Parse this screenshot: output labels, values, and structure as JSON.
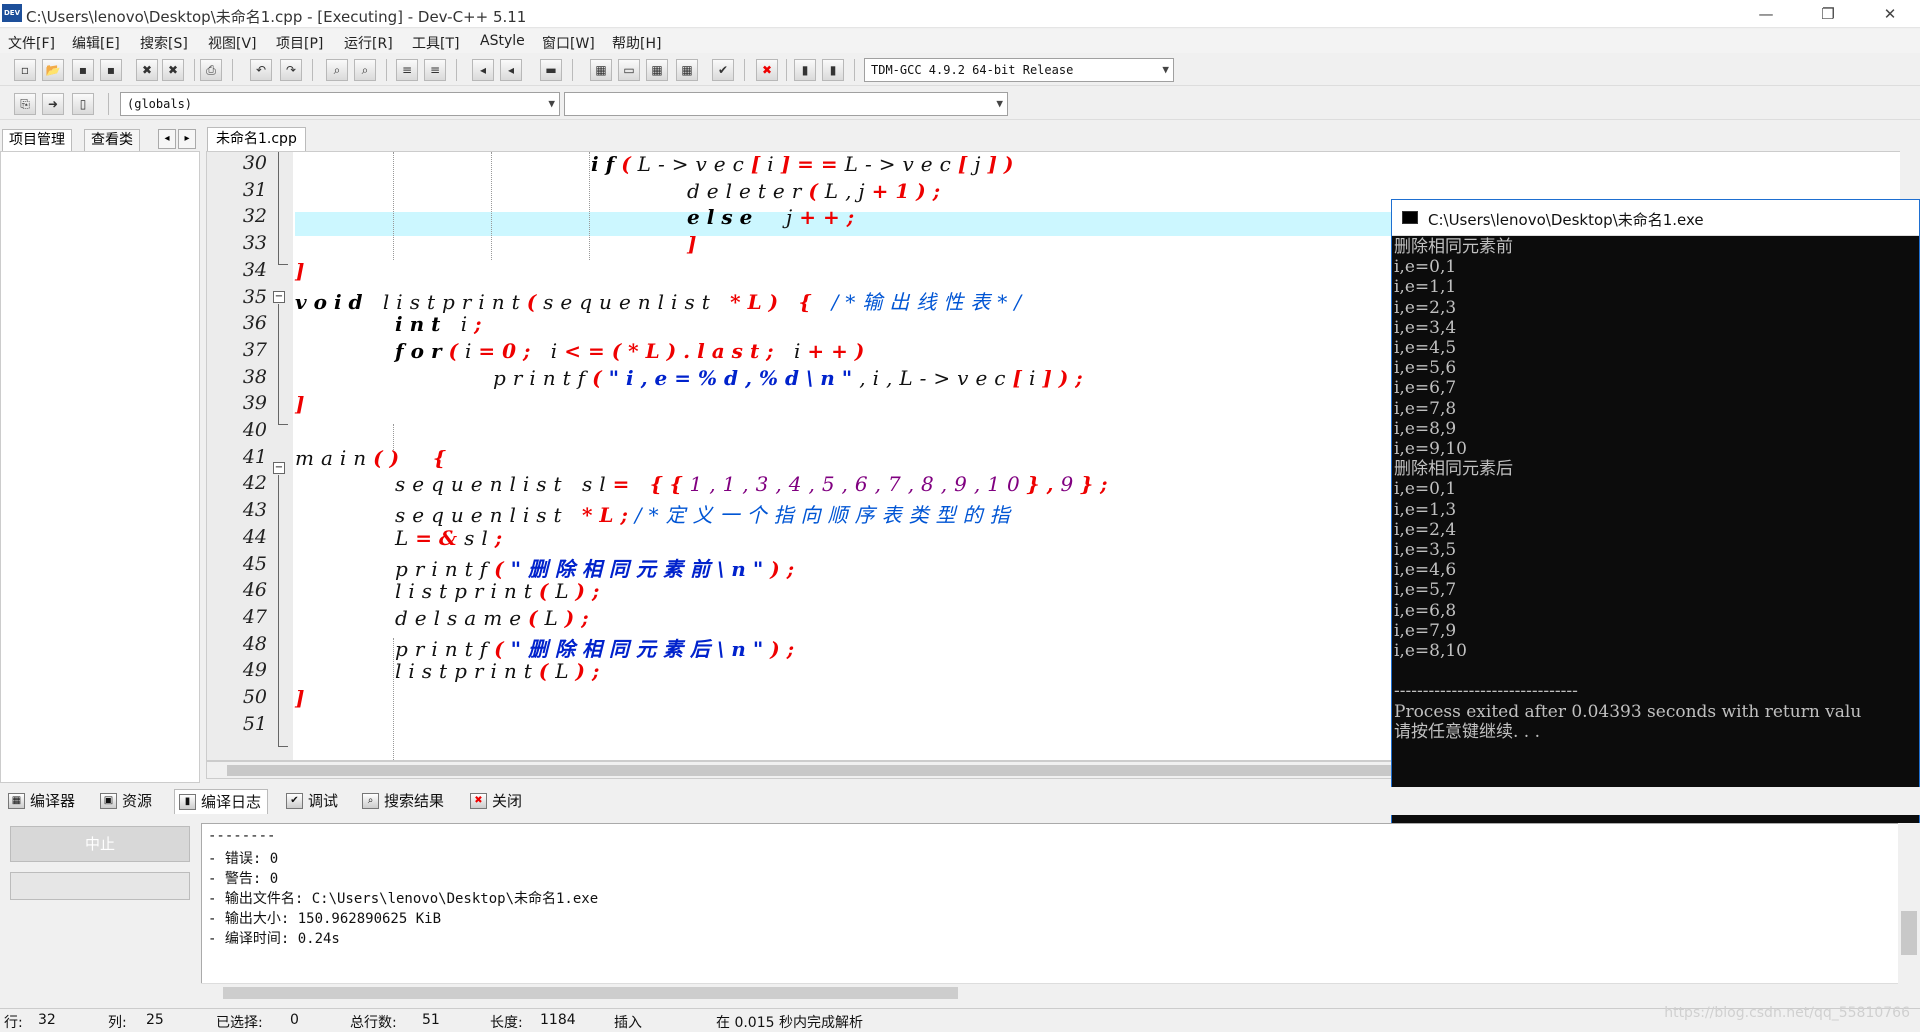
{
  "window": {
    "title": "C:\\Users\\lenovo\\Desktop\\未命名1.cpp - [Executing] - Dev-C++ 5.11",
    "app_icon": "DEV",
    "minimize": "—",
    "maximize": "❐",
    "close": "✕"
  },
  "menu": [
    "文件[F]",
    "编辑[E]",
    "搜索[S]",
    "视图[V]",
    "项目[P]",
    "运行[R]",
    "工具[T]",
    "AStyle",
    "窗口[W]",
    "帮助[H]"
  ],
  "toolbar": {
    "compiler_select": "TDM-GCC 4.9.2 64-bit Release",
    "scope_select": "(globals)",
    "symbol_select": ""
  },
  "left_tabs": [
    "项目管理",
    "查看类"
  ],
  "file_tab": "未命名1.cpp",
  "code": {
    "lines": [
      "30",
      "31",
      "32",
      "33",
      "34",
      "35",
      "36",
      "37",
      "38",
      "39",
      "40",
      "41",
      "42",
      "43",
      "44",
      "45",
      "46",
      "47",
      "48",
      "49",
      "50",
      "51"
    ],
    "l30": {
      "kw": "if",
      "a": "(",
      "b": "L->vec",
      "c": "[",
      "d": "i",
      "e": "]",
      "f": "==",
      "g": "L->vec",
      "h": "[",
      "i": "j",
      "j": "])"
    },
    "l31": {
      "a": "deleter",
      "b": "(",
      "c": "L,",
      "d": "j",
      "e": "+1);"
    },
    "l32": {
      "kw": "else",
      "a": "j",
      "b": "++;"
    },
    "l33": "]",
    "l34": "]",
    "l35": {
      "kw": "void",
      "a": "listprint",
      "b": "(",
      "c": "sequenlist",
      "d": "*L)",
      "e": "{",
      "f": "/*输出线性表*/"
    },
    "l36": {
      "kw": "int",
      "a": "i",
      "b": ";"
    },
    "l37": {
      "kw": "for",
      "a": "(",
      "b": "i",
      "c": "=0;",
      "d": "i",
      "e": "<=(",
      "f": "*L",
      ".g": "",
      "g": ").last;",
      "h": "i",
      "i": "++)"
    },
    "l38": {
      "a": "printf",
      "b": "(",
      "c": "\"i,e=%d,%d\\n\"",
      "d": ",i,L->vec",
      "e": "[",
      "f": "i",
      "g": "]);"
    },
    "l39": "]",
    "l41": {
      "a": "main",
      "b": "()",
      "c": "{"
    },
    "l42": {
      "a": "sequenlist",
      "b": "sl",
      "c": "=",
      "d": "{{",
      "e": "1,1,3,4,5,6,7,8,9,10",
      "f": "},",
      "g": "9",
      "h": "};"
    },
    "l43": {
      "a": "sequenlist",
      "b": "*L;",
      "c": "/*定义一个指向顺序表类型的指"
    },
    "l44": {
      "a": "L",
      "b": "=&",
      "c": "sl",
      ".d": "",
      "d": ";"
    },
    "l45": {
      "a": "printf",
      "b": "(",
      "c": "\"删除相同元素前\\n\"",
      "d": ");"
    },
    "l46": {
      "a": "listprint",
      "b": "(",
      "c": "L",
      "d": ");"
    },
    "l47": {
      "a": "delsame",
      "b": "(",
      "c": "L",
      "d": ");"
    },
    "l48": {
      "a": "printf",
      "b": "(",
      "c": "\"删除相同元素后\\n\"",
      "d": ");"
    },
    "l49": {
      "a": "listprint",
      "b": "(",
      "c": "L",
      "d": ");"
    },
    "l50": "]"
  },
  "console": {
    "title": "C:\\Users\\lenovo\\Desktop\\未命名1.exe",
    "output": "删除相同元素前\ni,e=0,1\ni,e=1,1\ni,e=2,3\ni,e=3,4\ni,e=4,5\ni,e=5,6\ni,e=6,7\ni,e=7,8\ni,e=8,9\ni,e=9,10\n删除相同元素后\ni,e=0,1\ni,e=1,3\ni,e=2,4\ni,e=3,5\ni,e=4,6\ni,e=5,7\ni,e=6,8\ni,e=7,9\ni,e=8,10\n\n--------------------------------\nProcess exited after 0.04393 seconds with return valu\n请按任意键继续. . ."
  },
  "bottom_tabs": [
    "编译器",
    "资源",
    "编译日志",
    "调试",
    "搜索结果",
    "关闭"
  ],
  "abort_label": "中止",
  "log": [
    "--------",
    "- 错误: 0",
    "- 警告: 0",
    "- 输出文件名: C:\\Users\\lenovo\\Desktop\\未命名1.exe",
    "- 输出大小: 150.962890625 KiB",
    "- 编译时间: 0.24s"
  ],
  "status": {
    "row_label": "行:",
    "row": "32",
    "col_label": "列:",
    "col": "25",
    "sel_label": "已选择:",
    "sel": "0",
    "total_label": "总行数:",
    "total": "51",
    "len_label": "长度:",
    "len": "1184",
    "mode": "插入",
    "parse": "在 0.015 秒内完成解析"
  },
  "watermark": "https://blog.csdn.net/qq_55810766"
}
